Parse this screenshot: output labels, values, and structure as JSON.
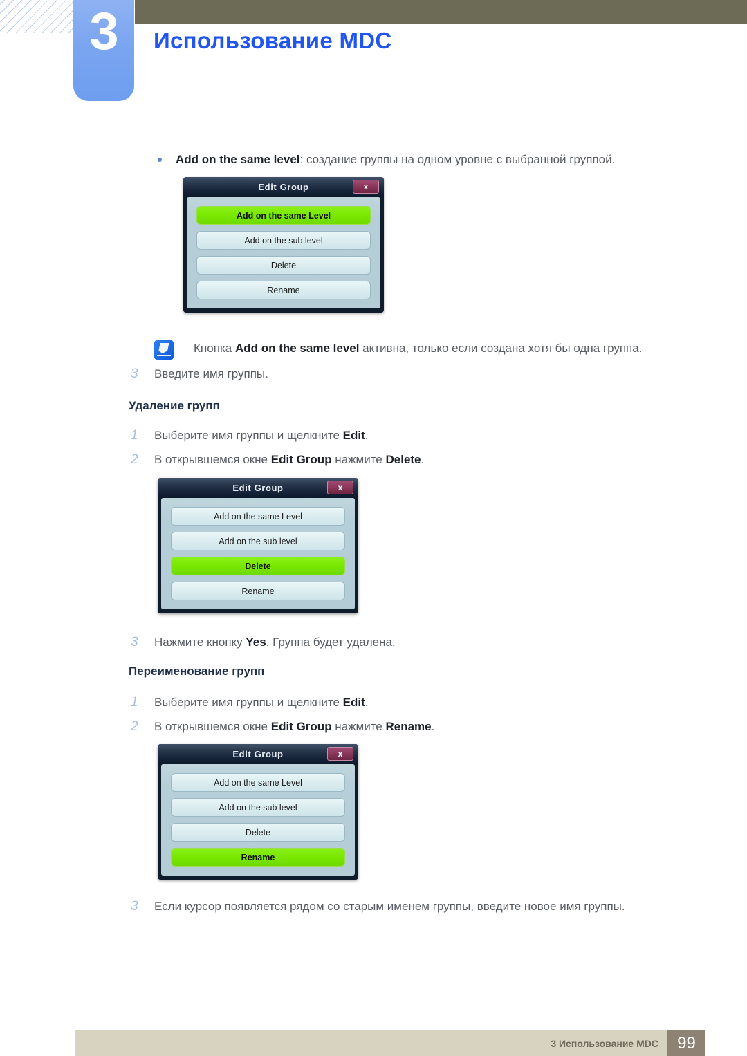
{
  "header": {
    "chapter_number": "3",
    "chapter_title": "Использование MDC"
  },
  "content": {
    "bullet": {
      "bold": "Add on the same level",
      "rest": ": создание группы на одном уровне с выбранной группой."
    },
    "note": {
      "icon": "note-pencil-icon",
      "pre": "Кнопка ",
      "bold": "Add on the same level",
      "post": " активна, только если создана хотя бы одна группа."
    },
    "step_add_3": {
      "num": "3",
      "text": "Введите имя группы."
    },
    "section_delete": {
      "heading": "Удаление групп",
      "steps": [
        {
          "num": "1",
          "pre": "Выберите имя группы и щелкните ",
          "bold": "Edit",
          "post": "."
        },
        {
          "num": "2",
          "pre": "В открывшемся окне ",
          "bold": "Edit Group",
          "mid": " нажмите ",
          "bold2": "Delete",
          "post": "."
        }
      ],
      "step3": {
        "num": "3",
        "pre": "Нажмите кнопку ",
        "bold": "Yes",
        "post": ". Группа будет удалена."
      }
    },
    "section_rename": {
      "heading": "Переименование групп",
      "steps": [
        {
          "num": "1",
          "pre": "Выберите имя группы и щелкните ",
          "bold": "Edit",
          "post": "."
        },
        {
          "num": "2",
          "pre": "В открывшемся окне ",
          "bold": "Edit Group",
          "mid": " нажмите ",
          "bold2": "Rename",
          "post": "."
        }
      ],
      "step3": {
        "num": "3",
        "text": "Если курсор появляется рядом со старым именем группы, введите новое имя группы."
      }
    }
  },
  "dialogs": [
    {
      "title": "Edit Group",
      "close_label": "x",
      "buttons": [
        {
          "label": "Add on the same Level",
          "active": true
        },
        {
          "label": "Add on the sub level",
          "active": false
        },
        {
          "label": "Delete",
          "active": false
        },
        {
          "label": "Rename",
          "active": false
        }
      ]
    },
    {
      "title": "Edit Group",
      "close_label": "x",
      "buttons": [
        {
          "label": "Add on the same Level",
          "active": false
        },
        {
          "label": "Add on the sub level",
          "active": false
        },
        {
          "label": "Delete",
          "active": true
        },
        {
          "label": "Rename",
          "active": false
        }
      ]
    },
    {
      "title": "Edit Group",
      "close_label": "x",
      "buttons": [
        {
          "label": "Add on the same Level",
          "active": false
        },
        {
          "label": "Add on the sub level",
          "active": false
        },
        {
          "label": "Delete",
          "active": false
        },
        {
          "label": "Rename",
          "active": true
        }
      ]
    }
  ],
  "footer": {
    "text": "3 Использование MDC",
    "page": "99"
  },
  "colors": {
    "accent_blue": "#2255ee",
    "olive_bar": "#6d6a55",
    "tab_blue": "#7aa5f0",
    "step_num": "#a9bde2",
    "highlight_green": "#78e800",
    "footer_bar": "#d8d2c0",
    "footer_page_box": "#8d8273"
  }
}
